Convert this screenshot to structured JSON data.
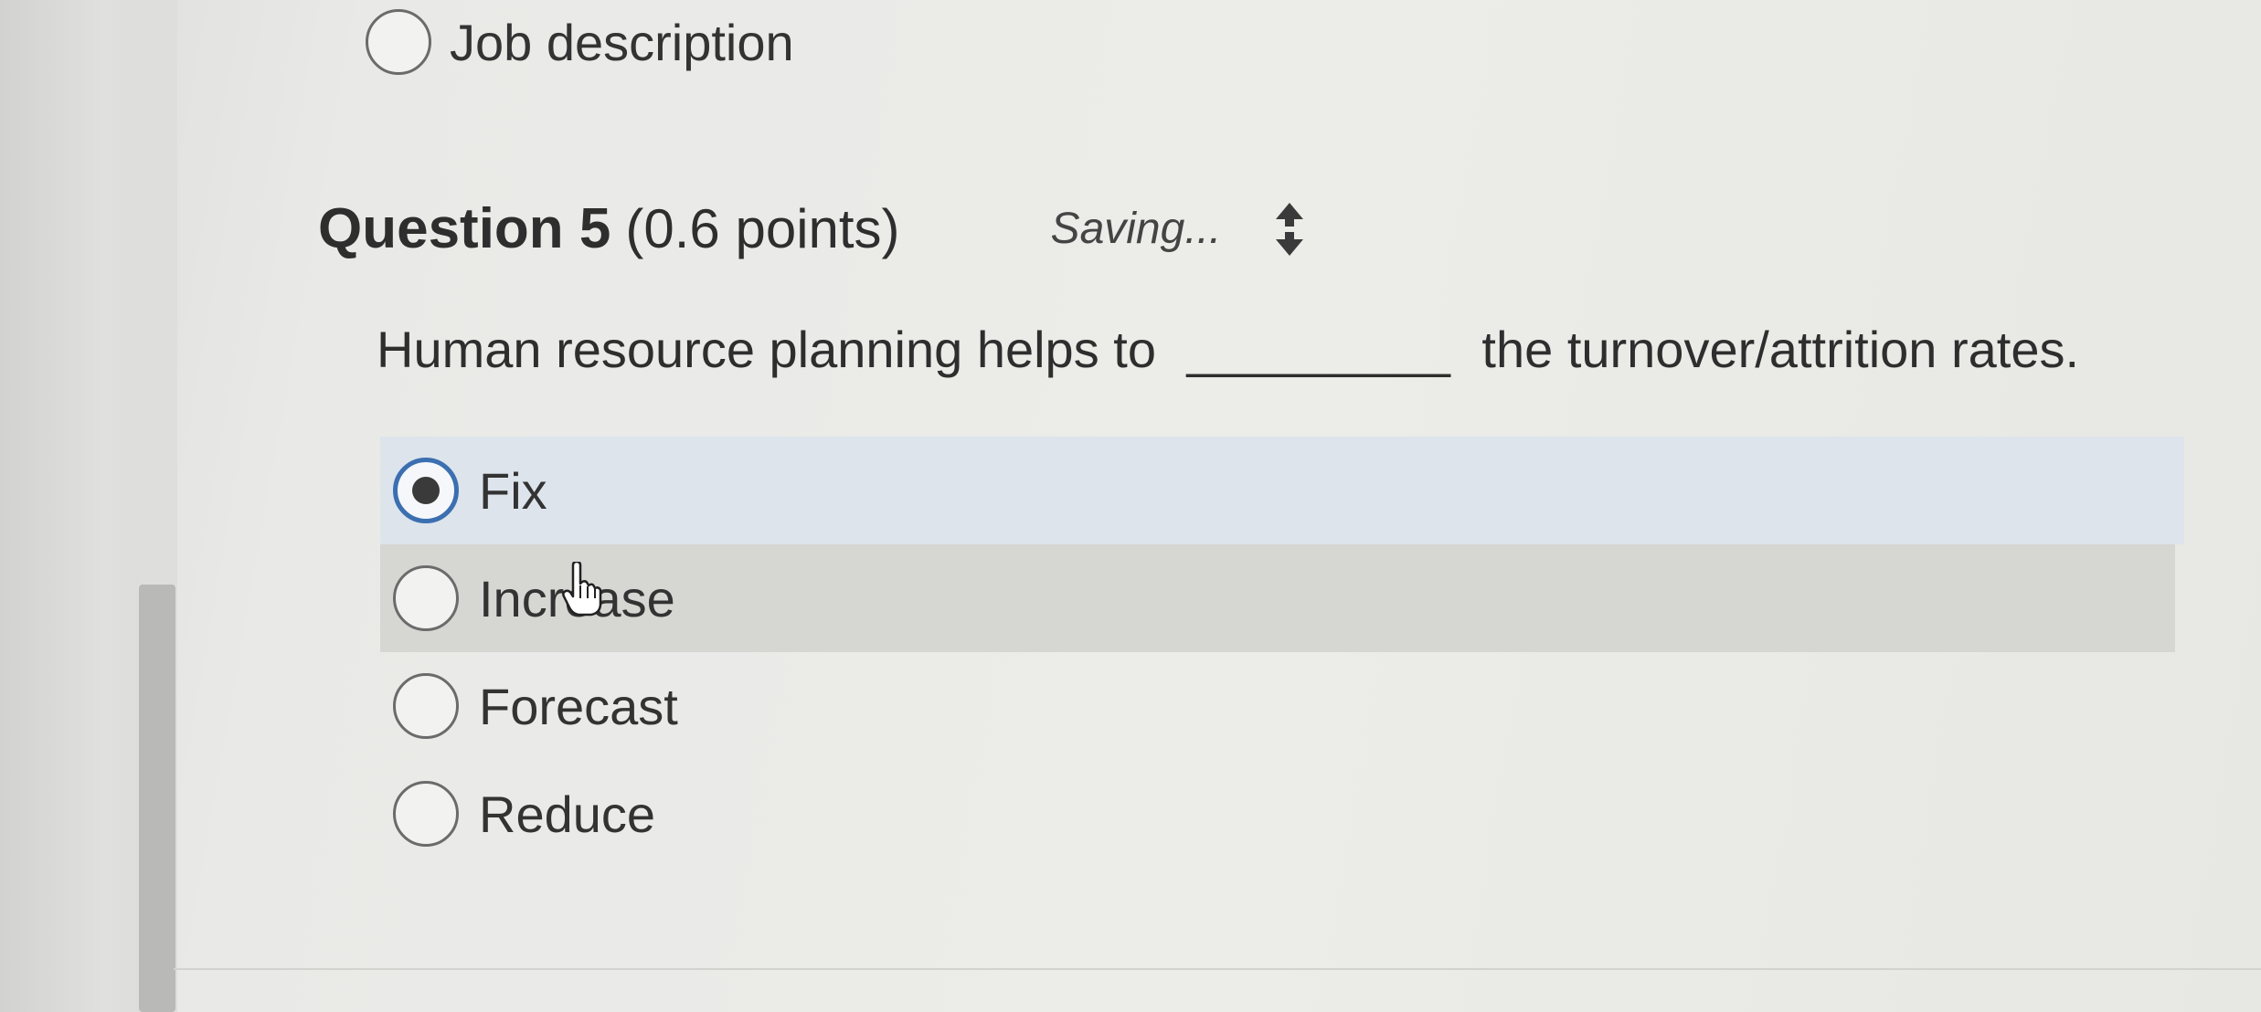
{
  "previous_option": {
    "label": "Job description",
    "selected": false
  },
  "question": {
    "title": "Question 5",
    "points": "(0.6 points)",
    "status": "Saving...",
    "status_icon": "sync-icon",
    "prompt_before": "Human resource planning helps to",
    "blank": "_________",
    "prompt_after": "the turnover/attrition rates."
  },
  "options": [
    {
      "label": "Fix",
      "selected": true
    },
    {
      "label": "Increase",
      "selected": false
    },
    {
      "label": "Forecast",
      "selected": false
    },
    {
      "label": "Reduce",
      "selected": false
    }
  ],
  "colors": {
    "selected_accent": "#3c6fb0",
    "selected_row_bg": "#dde4ec",
    "hover_row_bg": "#d6d6d3"
  }
}
